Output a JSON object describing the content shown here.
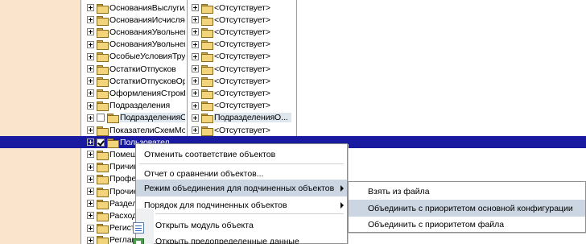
{
  "tree": {
    "rows": [
      {
        "left": "ОснованияВыслугиЛет",
        "right": "<Отсутствует>"
      },
      {
        "left": "ОснованияИсчисляемог...",
        "right": "<Отсутствует>"
      },
      {
        "left": "ОснованияУвольнения",
        "right": "<Отсутствует>"
      },
      {
        "left": "ОснованияУвольненияИ...",
        "right": "<Отсутствует>"
      },
      {
        "left": "ОсобыеУсловияТруда",
        "right": "<Отсутствует>"
      },
      {
        "left": "ОстаткиОтпусков",
        "right": "<Отсутствует>"
      },
      {
        "left": "ОстаткиОтпусковОргани...",
        "right": "<Отсутствует>"
      },
      {
        "left": "ОформленияСтрокПисем",
        "right": "<Отсутствует>"
      },
      {
        "left": "Подразделения",
        "right": "<Отсутствует>"
      },
      {
        "left": "ПодразделенияОрган...",
        "right": "ПодразделенияО..."
      },
      {
        "left": "ПоказателиСхемМотива...",
        "right": "<Отсутствует>"
      },
      {
        "left": "Пользовател",
        "right": ""
      },
      {
        "left": "Помещения",
        "right": ""
      },
      {
        "left": "ПричиныОтсутст",
        "right": ""
      },
      {
        "left": "ПрофессииРабо",
        "right": ""
      },
      {
        "left": "ПрочиеДоходыИ",
        "right": ""
      },
      {
        "left": "РазделыАнкеты",
        "right": ""
      },
      {
        "left": "РасходыБудущи",
        "right": ""
      },
      {
        "left": "РегистрацияВИ",
        "right": ""
      },
      {
        "left": "Регламентирова",
        "right": ""
      }
    ]
  },
  "context_menu": {
    "items": [
      {
        "label": "Отменить соответствие объектов",
        "icon": ""
      },
      {
        "label": "Отчет о сравнении объектов...",
        "icon": ""
      },
      {
        "label": "Режим объединения для подчиненных объектов",
        "icon": "",
        "submenu": true
      },
      {
        "label": "Порядок для подчиненных объектов",
        "icon": "",
        "submenu": true
      },
      {
        "label": "Открыть модуль объекта",
        "icon": "module-icon"
      },
      {
        "label": "Открыть предопределенные данные",
        "icon": "predefined-data-icon"
      }
    ]
  },
  "submenu": {
    "items": [
      {
        "label": "Взять из файла"
      },
      {
        "label": "Объединить с приоритетом основной конфигурации"
      },
      {
        "label": "Объединить с приоритетом файла"
      }
    ]
  },
  "colors": {
    "selection": "#1a1aa0",
    "strip": "#fbe4cc",
    "menu_hover": "#cbd6e2"
  }
}
